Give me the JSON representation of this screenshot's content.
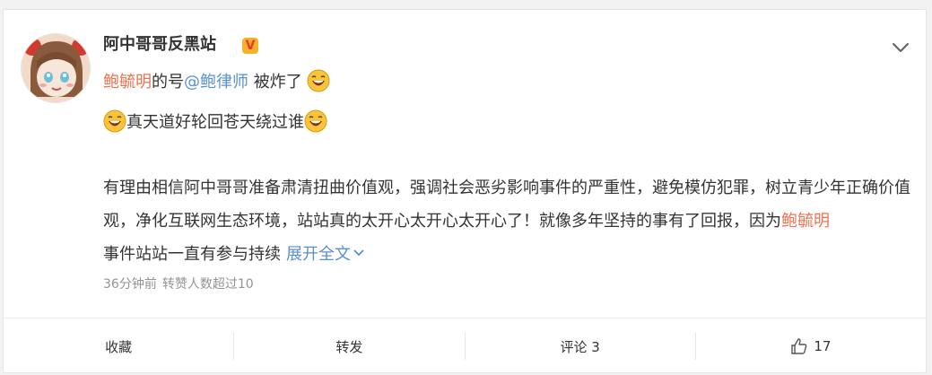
{
  "post": {
    "username": "阿中哥哥反黑站",
    "verified_badge": "V",
    "line1": {
      "mention_red": "鲍毓明",
      "text1": "的号",
      "mention_blue": "@鲍律师",
      "text2": " 被炸了"
    },
    "line2": {
      "text": "真天道好轮回苍天绕过谁"
    },
    "paragraph": {
      "part1": "有理由相信阿中哥哥准备肃清扭曲价值观，强调社会恶劣影响事件的严重性，避免模仿犯罪，树立青少年正确价值观，净化互联网生态环境，站站真的太开心太开心太开心了！就像多年坚持的事有了回报，因为",
      "mention_red": "鲍毓明",
      "part2": "事件站站一直有参与持续",
      "expand_label": "展开全文"
    },
    "meta": {
      "time": "36分钟前",
      "reposts_note": "转赞人数超过10"
    }
  },
  "actions": {
    "favorite": "收藏",
    "repost": "转发",
    "comment": "评论 3",
    "like_count": "17"
  },
  "colors": {
    "accent_red": "#eb7350",
    "link_blue": "#5b8fcd"
  }
}
